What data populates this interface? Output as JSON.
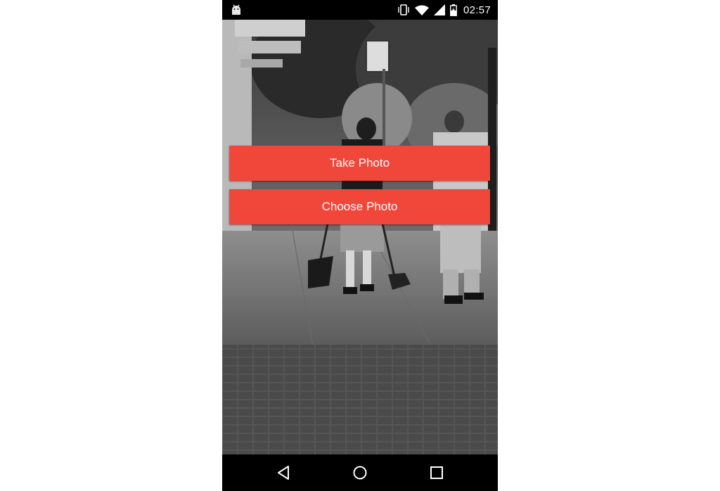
{
  "status_bar": {
    "time": "02:57",
    "icons": [
      "android-debug-icon",
      "vibrate-icon",
      "wifi-icon",
      "cell-signal-icon",
      "battery-charging-icon"
    ]
  },
  "background": {
    "description_icon": "street-photo"
  },
  "actions": {
    "take_photo_label": "Take Photo",
    "choose_photo_label": "Choose Photo"
  },
  "nav_bar": {
    "icons": [
      "back-icon",
      "home-icon",
      "recents-icon"
    ]
  },
  "colors": {
    "button": "#f1473b",
    "button_text": "#ffffff",
    "bars": "#000000"
  }
}
